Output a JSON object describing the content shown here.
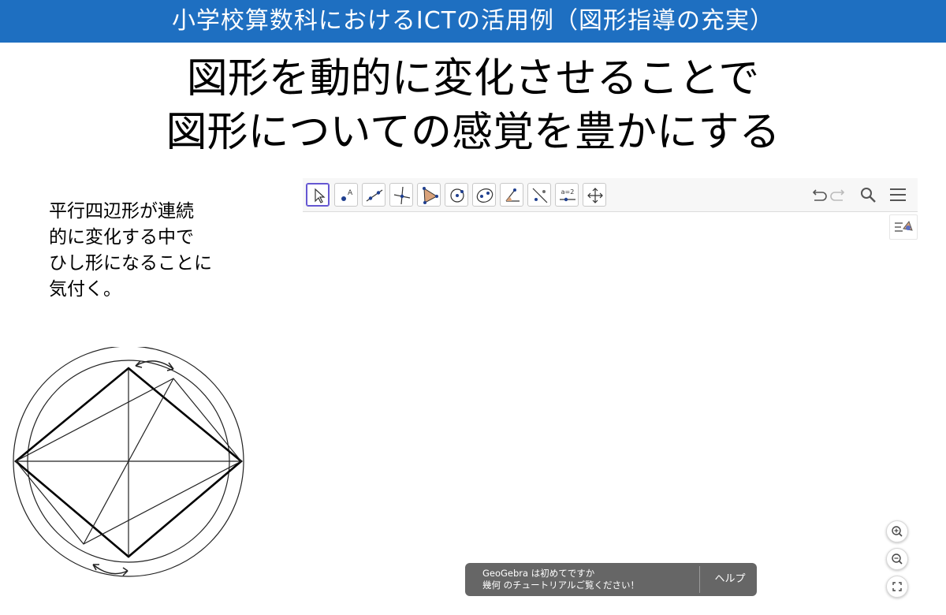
{
  "slide": {
    "banner_title": "小学校算数科におけるICTの活用例（図形指導の充実）",
    "main_title_line1": "図形を動的に変化させることで",
    "main_title_line2": "図形についての感覚を豊かにする",
    "description_lines": [
      "平行四辺形が連続",
      "的に変化する中で",
      "ひし形になることに",
      "気付く。"
    ]
  },
  "applet": {
    "toolbar_tools": [
      {
        "name": "move-tool-icon",
        "active": true
      },
      {
        "name": "point-tool-icon",
        "active": false
      },
      {
        "name": "line-tool-icon",
        "active": false
      },
      {
        "name": "perpendicular-line-tool-icon",
        "active": false
      },
      {
        "name": "polygon-tool-icon",
        "active": false
      },
      {
        "name": "circle-tool-icon",
        "active": false
      },
      {
        "name": "ellipse-tool-icon",
        "active": false
      },
      {
        "name": "angle-tool-icon",
        "active": false
      },
      {
        "name": "reflect-tool-icon",
        "active": false
      },
      {
        "name": "slider-tool-icon",
        "active": false
      },
      {
        "name": "move-graphics-view-tool-icon",
        "active": false
      }
    ],
    "slider_tool_label": "a=2",
    "toast": {
      "line1": "GeoGebra は初めてですか",
      "line2": "幾何 のチュートリアルご覧ください！",
      "help_label": "ヘルプ"
    },
    "colors": {
      "banner": "#1e6fc1",
      "active_tool_border": "#6557d2",
      "toast_bg": "#666666"
    }
  }
}
